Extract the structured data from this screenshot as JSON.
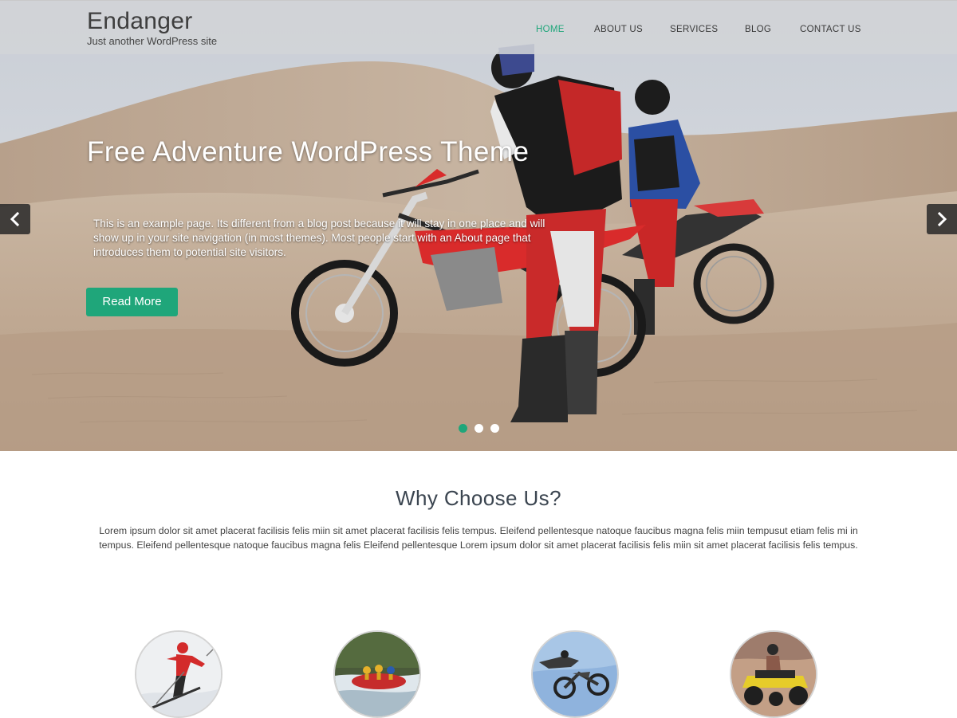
{
  "site": {
    "title": "Endanger",
    "tagline": "Just another WordPress site"
  },
  "nav": {
    "items": [
      {
        "label": "HOME",
        "active": true
      },
      {
        "label": "ABOUT US",
        "active": false
      },
      {
        "label": "SERVICES",
        "active": false
      },
      {
        "label": "BLOG",
        "active": false
      },
      {
        "label": "CONTACT US",
        "active": false
      }
    ]
  },
  "slider": {
    "title": "Free Adventure WordPress Theme",
    "text": "This is an example page. Its different from a blog post because it will stay in one place and will show up in your site navigation (in most themes). Most people start with an About page that introduces them to potential site visitors.",
    "button_label": "Read More",
    "prev_icon": "chevron-left-icon",
    "next_icon": "chevron-right-icon",
    "slide_count": 3,
    "active_slide": 1
  },
  "why": {
    "title": "Why Choose Us?",
    "text": "Lorem ipsum dolor sit amet placerat facilisis felis miin sit amet placerat facilisis felis tempus. Eleifend pellentesque natoque faucibus magna felis miin tempusut etiam felis mi in tempus. Eleifend pellentesque natoque faucibus magna felis Eleifend pellentesque Lorem ipsum dolor sit amet placerat facilisis felis miin sit amet placerat facilisis felis tempus."
  },
  "features": [
    {
      "image": "skiing-image"
    },
    {
      "image": "rafting-image"
    },
    {
      "image": "motocross-jump-image"
    },
    {
      "image": "atv-rider-image"
    }
  ],
  "colors": {
    "accent": "#1fa67a",
    "header_bg": "#d2d4d7",
    "heading": "#3b4550"
  }
}
